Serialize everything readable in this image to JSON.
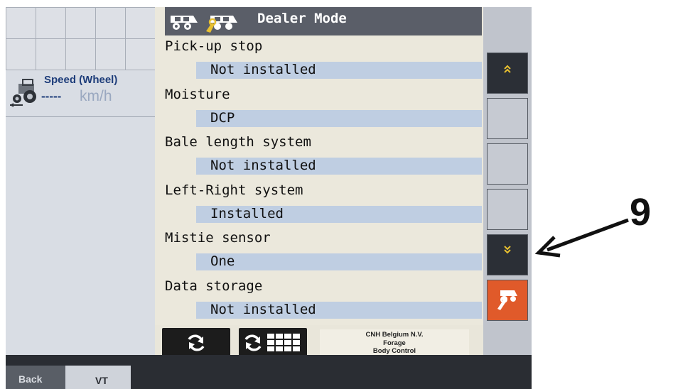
{
  "left_panel": {
    "speed_widget": {
      "label": "Speed (Wheel)",
      "value": "-----",
      "unit": "km/h"
    }
  },
  "header": {
    "title": "Dealer Mode"
  },
  "settings": [
    {
      "name": "Pick-up stop",
      "value": "Not installed"
    },
    {
      "name": "Moisture",
      "value": "DCP"
    },
    {
      "name": "Bale length system",
      "value": "Not installed"
    },
    {
      "name": "Left-Right system",
      "value": "Installed"
    },
    {
      "name": "Mistie sensor",
      "value": "One"
    },
    {
      "name": "Data storage",
      "value": "Not installed"
    }
  ],
  "footer": {
    "company_line1": "CNH Belgium N.V.",
    "company_line2": "Forage",
    "company_line3": "Body Control"
  },
  "softkeys": [
    {
      "icon": "scroll-up-icon"
    },
    {
      "icon": "empty"
    },
    {
      "icon": "empty"
    },
    {
      "icon": "empty"
    },
    {
      "icon": "scroll-down-icon"
    },
    {
      "icon": "baler-settings-icon"
    }
  ],
  "tabs": {
    "back_label": "Back",
    "vt_label": "VT"
  },
  "annotation": {
    "number": "9"
  },
  "colors": {
    "title_bar": "#5a5e68",
    "value_highlight": "#bfcee2",
    "panel_bg": "#ebe8dc",
    "softkey_orange": "#e05a2a",
    "accent_yellow": "#e8c030"
  }
}
